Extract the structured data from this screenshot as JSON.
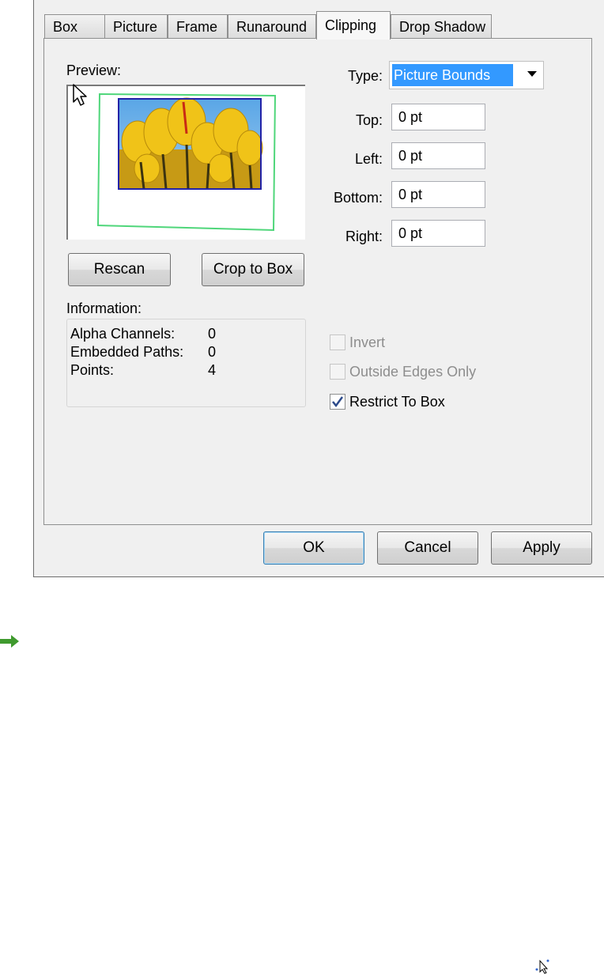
{
  "tabs": [
    {
      "label": "Box",
      "active": false
    },
    {
      "label": "Picture",
      "active": false
    },
    {
      "label": "Frame",
      "active": false
    },
    {
      "label": "Runaround",
      "active": false
    },
    {
      "label": "Clipping",
      "active": true
    },
    {
      "label": "Drop Shadow",
      "active": false
    }
  ],
  "preview": {
    "label": "Preview:"
  },
  "type": {
    "label": "Type:",
    "value": "Picture Bounds"
  },
  "fields": {
    "top": {
      "label": "Top:",
      "value": "0 pt"
    },
    "left": {
      "label": "Left:",
      "value": "0 pt"
    },
    "bottom": {
      "label": "Bottom:",
      "value": "0 pt"
    },
    "right": {
      "label": "Right:",
      "value": "0 pt"
    }
  },
  "buttons": {
    "rescan": "Rescan",
    "crop": "Crop to Box",
    "ok": "OK",
    "cancel": "Cancel",
    "apply": "Apply"
  },
  "information": {
    "label": "Information:",
    "rows": [
      {
        "name": "Alpha Channels:",
        "value": "0"
      },
      {
        "name": "Embedded Paths:",
        "value": "0"
      },
      {
        "name": "Points:",
        "value": "4"
      }
    ]
  },
  "options": {
    "invert": {
      "label": "Invert",
      "checked": false,
      "enabled": false
    },
    "outside": {
      "label": "Outside Edges Only",
      "checked": false,
      "enabled": false
    },
    "restrict": {
      "label": "Restrict To Box",
      "checked": true,
      "enabled": true
    }
  },
  "colors": {
    "selection": "#3399ff",
    "clip_path": "#4fd67a",
    "picture_border": "#2323a8",
    "arrow": "#3f9a2e"
  }
}
